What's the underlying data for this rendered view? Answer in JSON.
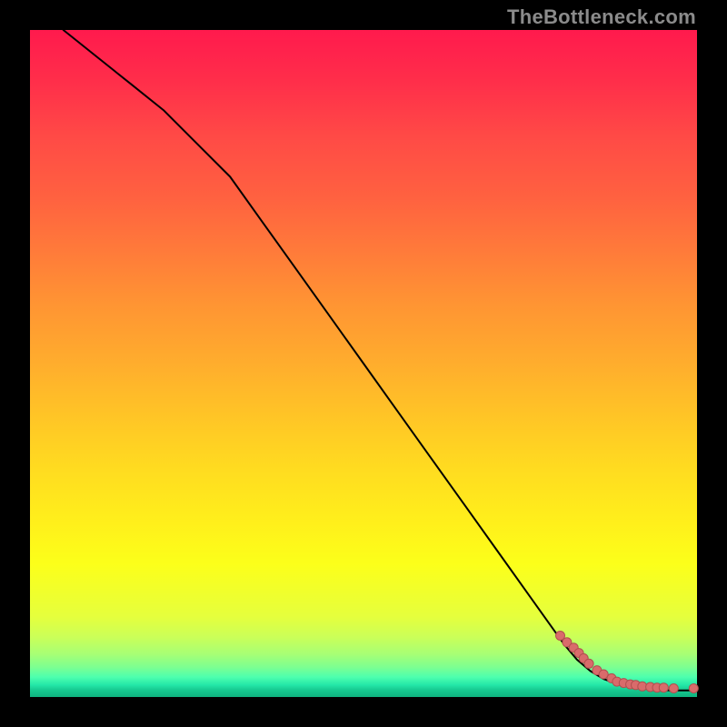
{
  "watermark": "TheBottleneck.com",
  "colors": {
    "frame": "#000000",
    "line": "#000000",
    "dot_fill": "#d96b6b",
    "dot_stroke": "#b24f4f",
    "watermark": "#8b8b8b"
  },
  "chart_data": {
    "type": "line",
    "title": "",
    "xlabel": "",
    "ylabel": "",
    "xlim": [
      0,
      100
    ],
    "ylim": [
      0,
      100
    ],
    "grid": false,
    "legend": false,
    "series": [
      {
        "name": "curve",
        "style": "line",
        "x": [
          5,
          10,
          15,
          20,
          25,
          30,
          35,
          40,
          45,
          50,
          55,
          60,
          65,
          70,
          75,
          80,
          82,
          84,
          86,
          88,
          90,
          92,
          94,
          96,
          98,
          100
        ],
        "y": [
          100,
          96,
          92,
          88,
          83,
          78,
          71,
          64,
          57,
          50,
          43,
          36,
          29,
          22,
          15,
          8,
          5.6,
          3.9,
          2.7,
          2.0,
          1.6,
          1.3,
          1.1,
          1.0,
          1.0,
          1.0
        ]
      },
      {
        "name": "dots",
        "style": "scatter",
        "x": [
          79.5,
          80.5,
          81.5,
          82.3,
          83.0,
          83.8,
          85.0,
          86.0,
          87.2,
          88.0,
          89.0,
          90.0,
          90.8,
          91.8,
          93.0,
          94.0,
          95.0,
          96.5,
          99.5
        ],
        "y": [
          9.2,
          8.2,
          7.4,
          6.6,
          5.8,
          5.0,
          4.0,
          3.4,
          2.8,
          2.3,
          2.1,
          1.9,
          1.8,
          1.6,
          1.5,
          1.4,
          1.4,
          1.3,
          1.3
        ]
      }
    ]
  }
}
